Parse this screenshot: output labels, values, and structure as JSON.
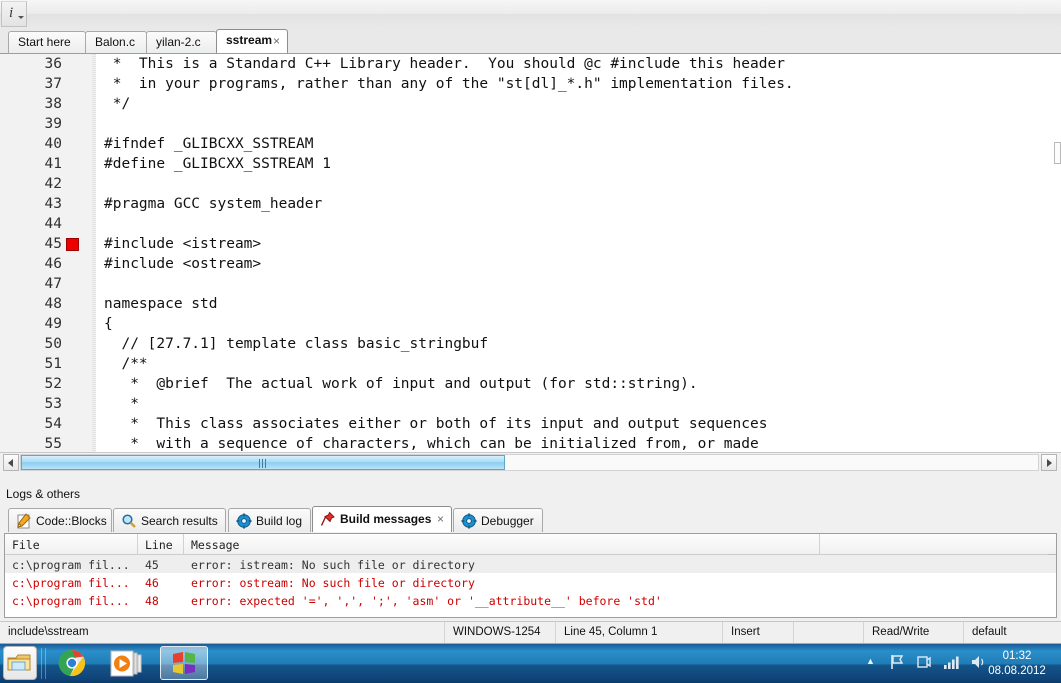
{
  "toolbar": {
    "button_glyph": "i",
    "button_name": "info-dropdown"
  },
  "editor_tabs": [
    {
      "label": "Start here",
      "active": false,
      "closable": false
    },
    {
      "label": "Balon.c",
      "active": false,
      "closable": false
    },
    {
      "label": "yilan-2.c",
      "active": false,
      "closable": false
    },
    {
      "label": "sstream",
      "active": true,
      "closable": true,
      "close_glyph": "×"
    }
  ],
  "code": {
    "lines": [
      {
        "num": "36",
        "text": " *  This is a Standard C++ Library header.  You should @c #include this header",
        "marker": false
      },
      {
        "num": "37",
        "text": " *  in your programs, rather than any of the \"st[dl]_*.h\" implementation files.",
        "marker": false
      },
      {
        "num": "38",
        "text": " */",
        "marker": false
      },
      {
        "num": "39",
        "text": "",
        "marker": false
      },
      {
        "num": "40",
        "text": "#ifndef _GLIBCXX_SSTREAM",
        "marker": false
      },
      {
        "num": "41",
        "text": "#define _GLIBCXX_SSTREAM 1",
        "marker": false
      },
      {
        "num": "42",
        "text": "",
        "marker": false
      },
      {
        "num": "43",
        "text": "#pragma GCC system_header",
        "marker": false
      },
      {
        "num": "44",
        "text": "",
        "marker": false
      },
      {
        "num": "45",
        "text": "#include <istream>",
        "marker": true
      },
      {
        "num": "46",
        "text": "#include <ostream>",
        "marker": false
      },
      {
        "num": "47",
        "text": "",
        "marker": false
      },
      {
        "num": "48",
        "text": "namespace std",
        "marker": false
      },
      {
        "num": "49",
        "text": "{",
        "marker": false
      },
      {
        "num": "50",
        "text": "  // [27.7.1] template class basic_stringbuf",
        "marker": false
      },
      {
        "num": "51",
        "text": "  /**",
        "marker": false
      },
      {
        "num": "52",
        "text": "   *  @brief  The actual work of input and output (for std::string).",
        "marker": false
      },
      {
        "num": "53",
        "text": "   *",
        "marker": false
      },
      {
        "num": "54",
        "text": "   *  This class associates either or both of its input and output sequences",
        "marker": false
      },
      {
        "num": "55",
        "text": "   *  with a sequence of characters, which can be initialized from, or made",
        "marker": false
      }
    ],
    "error_marker_color": "#ee0000"
  },
  "logs": {
    "title": "Logs & others",
    "tabs": [
      {
        "label": "Code::Blocks",
        "icon": "pencil-icon",
        "active": false
      },
      {
        "label": "Search results",
        "icon": "magnifier-icon",
        "active": false
      },
      {
        "label": "Build log",
        "icon": "gear-icon",
        "active": false
      },
      {
        "label": "Build messages",
        "icon": "pushpin-icon",
        "active": true,
        "close_glyph": "×"
      },
      {
        "label": "Debugger",
        "icon": "gear-icon",
        "active": false
      }
    ],
    "columns": [
      "File",
      "Line",
      "Message",
      ""
    ],
    "rows": [
      {
        "file": "c:\\program fil...",
        "line": "45",
        "message": "error: istream: No such file or directory",
        "selected": true
      },
      {
        "file": "c:\\program fil...",
        "line": "46",
        "message": "error: ostream: No such file or directory",
        "selected": false
      },
      {
        "file": "c:\\program fil...",
        "line": "48",
        "message": "error: expected '=', ',', ';', 'asm' or '__attribute__' before 'std'",
        "selected": false
      }
    ],
    "error_color": "#cc0000"
  },
  "statusbar": {
    "path": "include\\sstream",
    "encoding": "WINDOWS-1254",
    "caret": "Line 45, Column 1",
    "insert_mode": "Insert",
    "blank": "",
    "access": "Read/Write",
    "profile": "default"
  },
  "taskbar": {
    "start_label": "start-orb",
    "buttons": [
      {
        "name": "taskbar-chrome",
        "active": false
      },
      {
        "name": "taskbar-media-player",
        "active": false
      },
      {
        "name": "taskbar-codeblocks",
        "active": true
      }
    ],
    "tray": {
      "show_hidden": "▲",
      "action_center": "action-center-flag-icon",
      "network": "network-icon",
      "signal": "signal-bars-icon",
      "volume": "speaker-icon"
    },
    "clock_time": "01:32",
    "clock_date": "08.08.2012"
  }
}
